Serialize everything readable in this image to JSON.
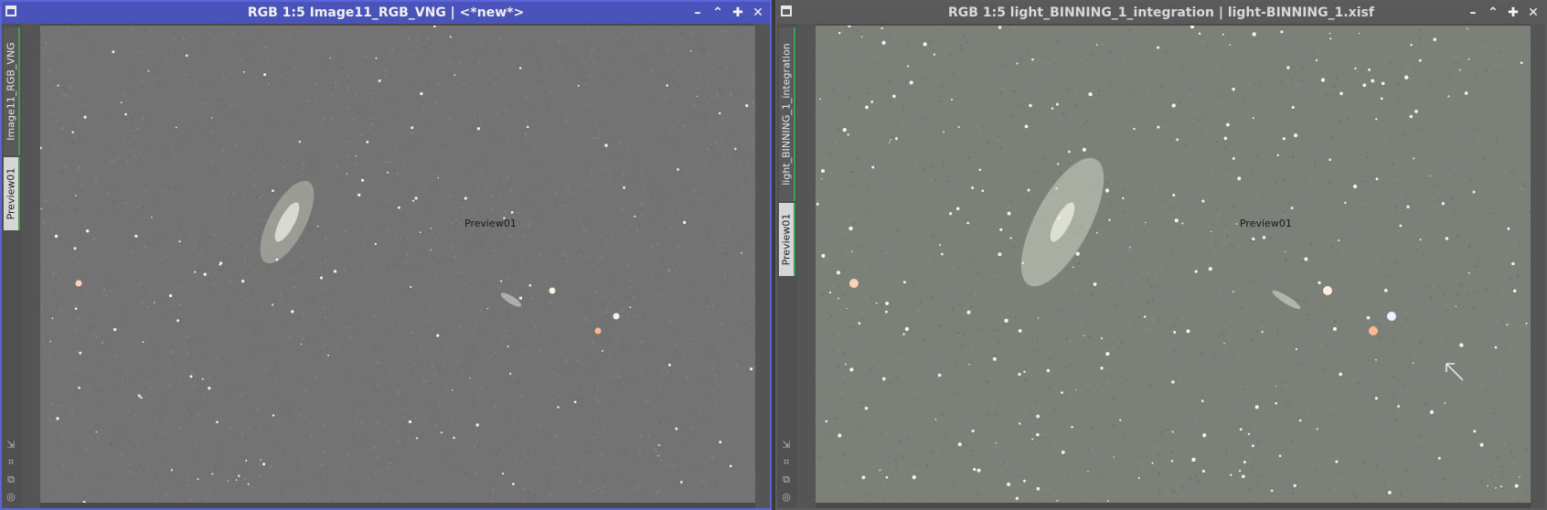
{
  "windows": [
    {
      "title": "RGB 1:5 Image11_RGB_VNG | <*new*>",
      "active": true,
      "tabs": [
        {
          "label": "Image11_RGB_VNG",
          "selected": false
        },
        {
          "label": "Preview01",
          "selected": true
        }
      ],
      "preview_label": "Preview01",
      "controls": [
        "minimize-icon",
        "shade-icon",
        "maximize-icon",
        "close-icon"
      ],
      "side_icons": [
        "fit-icon",
        "zoom-icon",
        "clone-icon",
        "settings-icon"
      ]
    },
    {
      "title": "RGB 1:5 light_BINNING_1_integration | light-BINNING_1.xisf",
      "active": false,
      "tabs": [
        {
          "label": "light_BINNING_1_integration",
          "selected": false
        },
        {
          "label": "Preview01",
          "selected": true
        }
      ],
      "preview_label": "Preview01",
      "controls": [
        "minimize-icon",
        "shade-icon",
        "maximize-icon",
        "close-icon"
      ],
      "side_icons": [
        "fit-icon",
        "zoom-icon",
        "clone-icon",
        "settings-icon"
      ]
    }
  ],
  "colors": {
    "active_border": "#5a64d8",
    "active_title": "#4a54b8",
    "inactive_title": "#5a5a5a",
    "tab_accent": "#3ca050"
  }
}
